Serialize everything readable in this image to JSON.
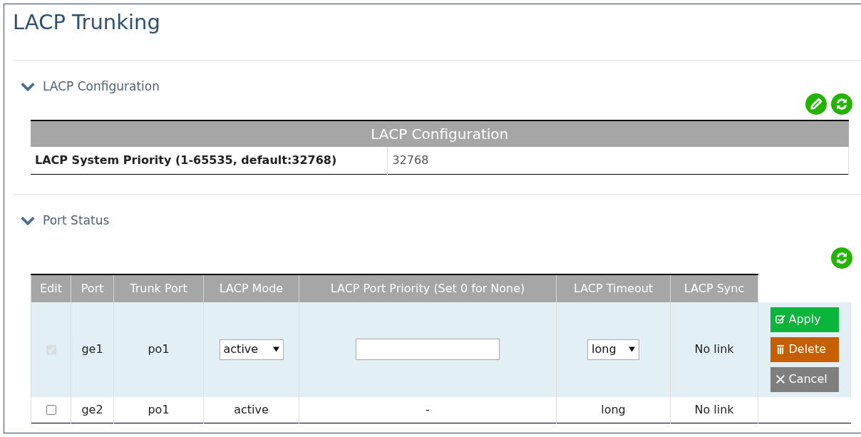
{
  "title": "LACP Trunking",
  "sections": [
    {
      "kind": "config",
      "heading": "LACP Configuration",
      "expanded": true,
      "tools": [
        {
          "kind": "edit"
        },
        {
          "kind": "refresh"
        }
      ],
      "table": {
        "caption": "LACP Configuration",
        "rows": [
          {
            "label": "LACP System Priority (1-65535, default:32768)",
            "value": "32768"
          }
        ]
      }
    },
    {
      "kind": "ports",
      "heading": "Port Status",
      "expanded": true,
      "tools": [
        {
          "kind": "refresh"
        }
      ],
      "table": {
        "columns": [
          "Edit",
          "Port",
          "Trunk Port",
          "LACP Mode",
          "LACP Port Priority (Set 0 for None)",
          "LACP Timeout",
          "LACP Sync"
        ],
        "rows": [
          {
            "kind": "editing",
            "checked": true,
            "disabled": true,
            "port": "ge1",
            "trunk_port": "po1",
            "mode": "active",
            "priority": "",
            "timeout": "long",
            "sync": "No link",
            "actions": [
              {
                "kind": "apply",
                "label": "Apply"
              },
              {
                "kind": "delete",
                "label": "Delete"
              },
              {
                "kind": "cancel",
                "label": "Cancel"
              }
            ]
          },
          {
            "kind": "view",
            "checked": false,
            "disabled": false,
            "port": "ge2",
            "trunk_port": "po1",
            "mode": "active",
            "priority": "-",
            "timeout": "long",
            "sync": "No link"
          }
        ]
      }
    }
  ]
}
